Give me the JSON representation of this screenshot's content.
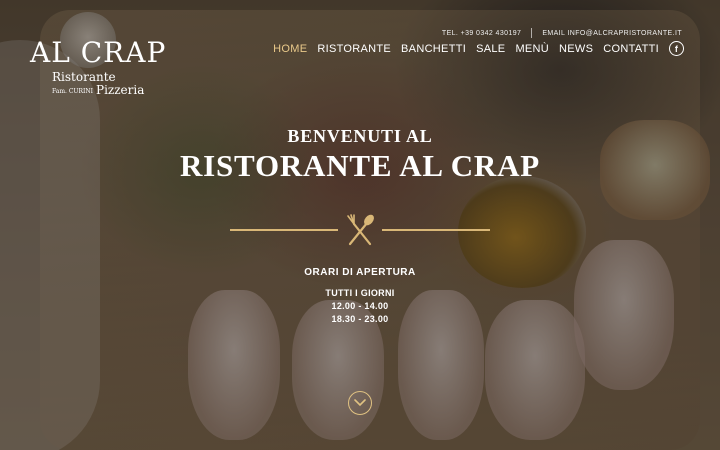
{
  "logo": {
    "name": "AL CRAP",
    "subtitle": "Ristorante",
    "owner": "Fam. CURINI",
    "pizzeria": "Pizzeria"
  },
  "contacts": {
    "phone": "TEL. +39 0342 430197",
    "email": "EMAIL INFO@ALCRAPRISTORANTE.IT"
  },
  "nav": {
    "items": [
      {
        "label": "HOME",
        "active": true
      },
      {
        "label": "RISTORANTE"
      },
      {
        "label": "BANCHETTI"
      },
      {
        "label": "SALE"
      },
      {
        "label": "MENÙ"
      },
      {
        "label": "NEWS"
      },
      {
        "label": "CONTATTI"
      }
    ],
    "facebook_icon": "facebook-icon",
    "facebook_glyph": "f"
  },
  "hero": {
    "welcome": "BENVENUTI AL",
    "title": "RISTORANTE AL CRAP",
    "divider_icon": "fork-spoon-icon",
    "hours_title": "ORARI DI APERTURA",
    "hours_days": "TUTTI I GIORNI",
    "hours": [
      "12.00 - 14.00",
      "18.30 - 23.00"
    ],
    "scroll_icon": "chevron-down-icon"
  },
  "colors": {
    "accent": "#d9b777",
    "nav_active": "#e9c98a"
  }
}
